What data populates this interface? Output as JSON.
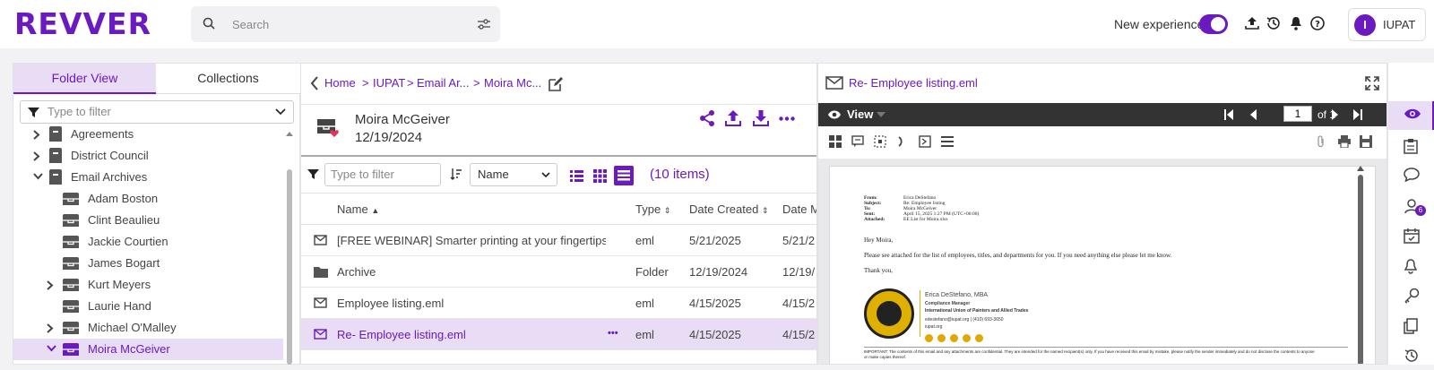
{
  "app": {
    "logo_text": "REVVER",
    "brand_color": "#6b1ac0"
  },
  "header": {
    "search_placeholder": "Search",
    "new_experience_label": "New experience",
    "new_experience_on": true,
    "user_initial": "I",
    "user_name": "IUPAT"
  },
  "left": {
    "tabs": [
      {
        "label": "Folder View",
        "active": true
      },
      {
        "label": "Collections",
        "active": false
      }
    ],
    "filter_placeholder": "Type to filter",
    "tree": [
      {
        "label": "Agreements",
        "level": 1,
        "expander": "collapsed",
        "icon": "cabinet-icon"
      },
      {
        "label": "District Council",
        "level": 1,
        "expander": "collapsed",
        "icon": "cabinet-icon"
      },
      {
        "label": "Email Archives",
        "level": 1,
        "expander": "expanded",
        "icon": "cabinet-icon"
      },
      {
        "label": "Adam Boston",
        "level": 2,
        "expander": "none",
        "icon": "drawer-icon"
      },
      {
        "label": "Clint Beaulieu",
        "level": 2,
        "expander": "none",
        "icon": "drawer-icon"
      },
      {
        "label": "Jackie Courtien",
        "level": 2,
        "expander": "none",
        "icon": "drawer-icon"
      },
      {
        "label": "James Bogart",
        "level": 2,
        "expander": "none",
        "icon": "drawer-icon"
      },
      {
        "label": "Kurt Meyers",
        "level": 2,
        "expander": "collapsed",
        "icon": "drawer-icon"
      },
      {
        "label": "Laurie Hand",
        "level": 2,
        "expander": "none",
        "icon": "drawer-icon"
      },
      {
        "label": "Michael O'Malley",
        "level": 2,
        "expander": "collapsed",
        "icon": "drawer-icon"
      },
      {
        "label": "Moira McGeiver",
        "level": 2,
        "expander": "expanded",
        "icon": "drawer-icon",
        "selected": true
      }
    ]
  },
  "middle": {
    "breadcrumbs": [
      "Home",
      "IUPAT",
      "Email Ar...",
      "Moira Mc..."
    ],
    "folder_name": "Moira McGeiver",
    "folder_date": "12/19/2024",
    "filter_placeholder": "Type to filter",
    "sort_value": "Name",
    "item_count": "(10 items)",
    "columns": [
      "Name",
      "Type",
      "Date Created",
      "Date M"
    ],
    "rows": [
      {
        "icon": "email-icon",
        "name": "[FREE WEBINAR] Smarter printing at your fingertips.em",
        "type": "eml",
        "created": "5/21/2025",
        "modified": "5/21/2"
      },
      {
        "icon": "folder-icon",
        "name": "Archive",
        "type": "Folder",
        "created": "12/19/2024",
        "modified": "12/19/"
      },
      {
        "icon": "email-icon",
        "name": "Employee listing.eml",
        "type": "eml",
        "created": "4/15/2025",
        "modified": "4/15/2"
      },
      {
        "icon": "email-icon",
        "name": "Re- Employee listing.eml",
        "type": "eml",
        "created": "4/15/2025",
        "modified": "4/15/2",
        "selected": true,
        "more": "•••"
      }
    ]
  },
  "viewer": {
    "title": "Re- Employee listing.eml",
    "mode_label": "View",
    "page_value": "1",
    "page_of": "of 1",
    "doc": {
      "header_lines": [
        {
          "k": "From:",
          "v": "Erica DeStefano"
        },
        {
          "k": "Subject:",
          "v": "Re: Employee listing"
        },
        {
          "k": "To:",
          "v": "Moira McGeiver"
        },
        {
          "k": "Sent:",
          "v": "April 15, 2025 1:27 PM (UTC+00:00)"
        },
        {
          "k": "Attached:",
          "v": "EE List for Moira.xlsx"
        }
      ],
      "greeting": "Hey Moira,",
      "body": "Please see attached for the list of employees, titles, and departments for you.  If you need anything else please let me know.",
      "closing": "Thank you,",
      "sig_name": "Erica DeStefano, MBA",
      "sig_title": "Compliance Manager",
      "sig_org": "International Union of Painters and Allied Trades",
      "sig_contact": "edestefano@iupat.org  |  (410) 693-3650",
      "sig_site": "iupat.org",
      "footer": "IMPORTANT: The contents of this email and any attachments are confidential. They are intended for the named recipient(s) only. If you have received this email by mistake, please notify the sender immediately and do not disclose the contents to anyone",
      "footer2": "or make copies thereof."
    }
  },
  "sidebar_icons": [
    {
      "name": "view-eye-icon",
      "active": true
    },
    {
      "name": "clipboard-icon"
    },
    {
      "name": "comment-icon"
    },
    {
      "name": "user-icon",
      "badge": "6"
    },
    {
      "name": "calendar-icon"
    },
    {
      "name": "bell-icon"
    },
    {
      "name": "key-icon"
    },
    {
      "name": "copy-icon"
    },
    {
      "name": "history-icon"
    }
  ]
}
